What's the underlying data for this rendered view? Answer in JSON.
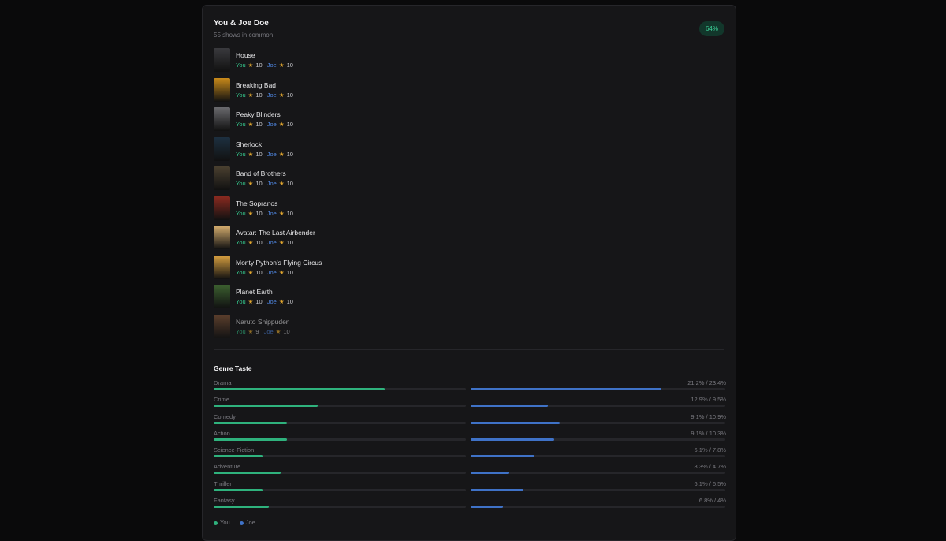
{
  "header": {
    "title": "You & Joe Doe",
    "subtitle": "55 shows in common",
    "match_badge": "64%"
  },
  "shows": [
    {
      "name": "House",
      "you_label": "You",
      "you_rating": "10",
      "joe_label": "Joe",
      "joe_rating": "10"
    },
    {
      "name": "Breaking Bad",
      "you_label": "You",
      "you_rating": "10",
      "joe_label": "Joe",
      "joe_rating": "10"
    },
    {
      "name": "Peaky Blinders",
      "you_label": "You",
      "you_rating": "10",
      "joe_label": "Joe",
      "joe_rating": "10"
    },
    {
      "name": "Sherlock",
      "you_label": "You",
      "you_rating": "10",
      "joe_label": "Joe",
      "joe_rating": "10"
    },
    {
      "name": "Band of Brothers",
      "you_label": "You",
      "you_rating": "10",
      "joe_label": "Joe",
      "joe_rating": "10"
    },
    {
      "name": "The Sopranos",
      "you_label": "You",
      "you_rating": "10",
      "joe_label": "Joe",
      "joe_rating": "10"
    },
    {
      "name": "Avatar: The Last Airbender",
      "you_label": "You",
      "you_rating": "10",
      "joe_label": "Joe",
      "joe_rating": "10"
    },
    {
      "name": "Monty Python's Flying Circus",
      "you_label": "You",
      "you_rating": "10",
      "joe_label": "Joe",
      "joe_rating": "10"
    },
    {
      "name": "Planet Earth",
      "you_label": "You",
      "you_rating": "10",
      "joe_label": "Joe",
      "joe_rating": "10"
    },
    {
      "name": "Naruto Shippuden",
      "you_label": "You",
      "you_rating": "9",
      "joe_label": "Joe",
      "joe_rating": "10"
    }
  ],
  "poster_colors": [
    "#3a3a3e",
    "#c98a1a",
    "#6a6a6e",
    "#1d3040",
    "#4a4030",
    "#8a2a20",
    "#d8b070",
    "#d8a040",
    "#3c6030",
    "#8a5a3a"
  ],
  "genre_section": {
    "title": "Genre Taste",
    "genres": [
      {
        "name": "Drama",
        "pct_text": "21.2% / 23.4%",
        "you": 21.2,
        "joe": 23.4
      },
      {
        "name": "Crime",
        "pct_text": "12.9% / 9.5%",
        "you": 12.9,
        "joe": 9.5
      },
      {
        "name": "Comedy",
        "pct_text": "9.1% / 10.9%",
        "you": 9.1,
        "joe": 10.9
      },
      {
        "name": "Action",
        "pct_text": "9.1% / 10.3%",
        "you": 9.1,
        "joe": 10.3
      },
      {
        "name": "Science-Fiction",
        "pct_text": "6.1% / 7.8%",
        "you": 6.1,
        "joe": 7.8
      },
      {
        "name": "Adventure",
        "pct_text": "8.3% / 4.7%",
        "you": 8.3,
        "joe": 4.7
      },
      {
        "name": "Thriller",
        "pct_text": "6.1% / 6.5%",
        "you": 6.1,
        "joe": 6.5
      },
      {
        "name": "Fantasy",
        "pct_text": "6.8% / 4%",
        "you": 6.8,
        "joe": 4.0
      }
    ],
    "bar_scale_max": 100
  },
  "legend": {
    "you_label": "You",
    "joe_label": "Joe"
  },
  "colors": {
    "you_accent": "#2fb27d",
    "joe_accent": "#3f72c7",
    "star": "#e2a72e",
    "badge_bg": "#12372b",
    "badge_text": "#3fd39a"
  }
}
